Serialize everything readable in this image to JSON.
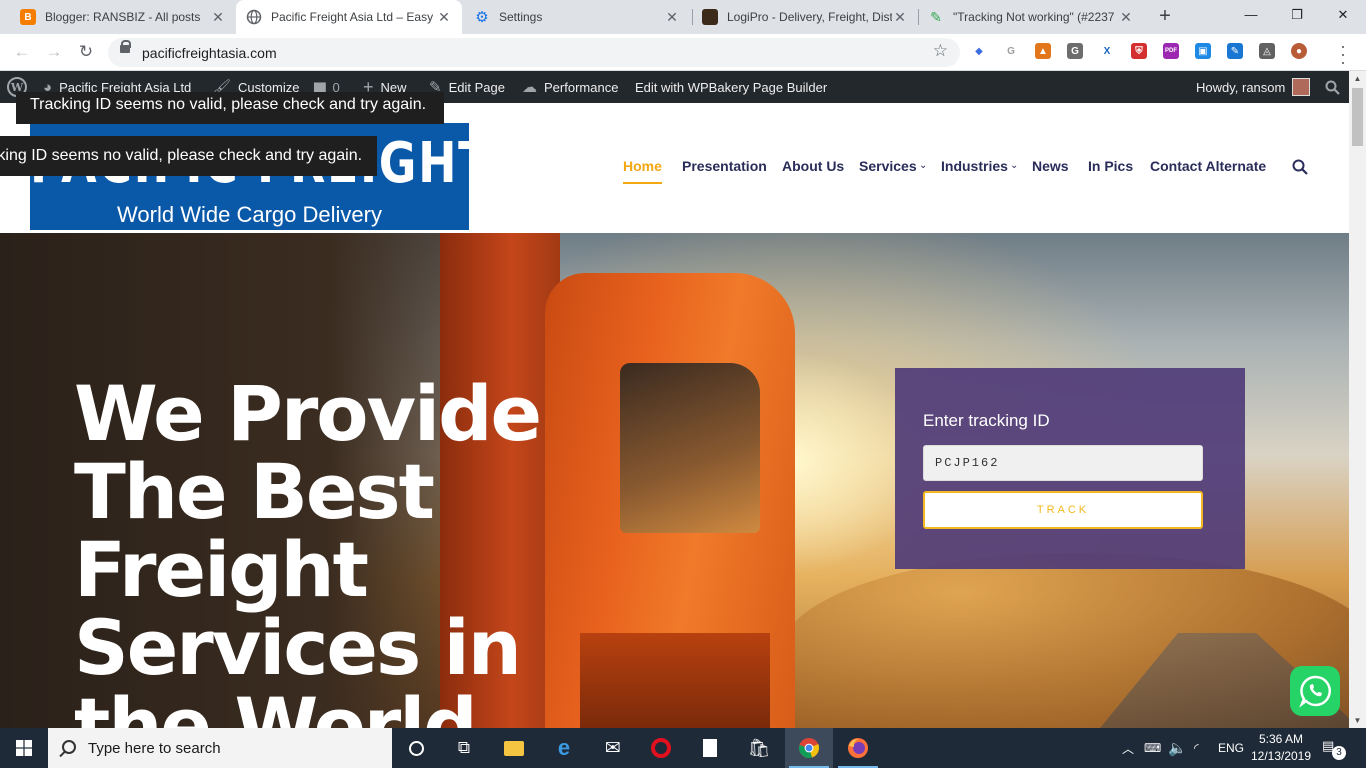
{
  "browser": {
    "tabs": [
      {
        "title": "Blogger: RANSBIZ - All posts",
        "icon": "blogger-icon",
        "color": "#f57d00"
      },
      {
        "title": "Pacific Freight Asia Ltd – Easy t",
        "icon": "globe-icon",
        "color": "#5f6368"
      },
      {
        "title": "Settings",
        "icon": "gear-icon",
        "color": "#1a73e8"
      },
      {
        "title": "LogiPro - Delivery, Freight, Dist",
        "icon": "logipro-icon",
        "color": "#3b2a1a"
      },
      {
        "title": "\"Tracking Not working\" (#2237",
        "icon": "ticket-icon",
        "color": "#34a853"
      }
    ],
    "new_tab": "+",
    "controls": {
      "minimize": "—",
      "maximize": "❐",
      "close": "✕"
    },
    "url": "pacificfreightasia.com",
    "extensions": [
      {
        "icon": "ethereum-icon",
        "glyph": "◆",
        "color": "#3c6ee0"
      },
      {
        "icon": "google-icon",
        "glyph": "G",
        "color": "#9e9e9e"
      },
      {
        "icon": "metamask-icon",
        "glyph": "▲",
        "color": "#e2761b"
      },
      {
        "icon": "grammarly-icon",
        "glyph": "G",
        "color": "#6d6d6d"
      },
      {
        "icon": "x-extension-icon",
        "glyph": "X",
        "color": "#1565c0"
      },
      {
        "icon": "shield-icon",
        "glyph": "⛨",
        "color": "#d32f2f"
      },
      {
        "icon": "pdf-icon",
        "glyph": "PDF",
        "color": "#9c27b0"
      },
      {
        "icon": "screenshot-icon",
        "glyph": "▣",
        "color": "#1e88e5"
      },
      {
        "icon": "edit-icon",
        "glyph": "✎",
        "color": "#1976d2"
      },
      {
        "icon": "drive-icon",
        "glyph": "◬",
        "color": "#616161"
      },
      {
        "icon": "profile-avatar-icon",
        "glyph": "●",
        "color": "#b85c38"
      }
    ]
  },
  "adminbar": {
    "site_name": "Pacific Freight Asia Ltd",
    "customize": "Customize",
    "comments_count": "0",
    "new": "New",
    "edit_page": "Edit Page",
    "performance": "Performance",
    "wpbakery": "Edit with WPBakery Page Builder",
    "howdy": "Howdy, ransom"
  },
  "tooltips": {
    "top": "Tracking ID seems no valid, please check and try again.",
    "middle": "Tracking ID seems no valid, please check and try again."
  },
  "site": {
    "logo_text": "PACIFIC FREIGHT ASIA",
    "logo_tagline": "World Wide Cargo Delivery",
    "nav": [
      "Home",
      "Presentation",
      "About Us",
      "Services",
      "Industries",
      "News",
      "In Pics",
      "Contact Alternate"
    ],
    "hero_title": "We Provide\nThe Best\nFreight\nServices in\nthe World",
    "tracking": {
      "label": "Enter tracking ID",
      "value": "PCJP162",
      "button": "TRACK"
    },
    "colors": {
      "accent": "#f3a712",
      "nav": "#2a2d5a",
      "logo_bg": "#0a58a8",
      "whatsapp": "#25d366"
    }
  },
  "taskbar": {
    "search_placeholder": "Type here to search",
    "language": "ENG",
    "time": "5:36 AM",
    "date": "12/13/2019",
    "notifications": "3"
  }
}
